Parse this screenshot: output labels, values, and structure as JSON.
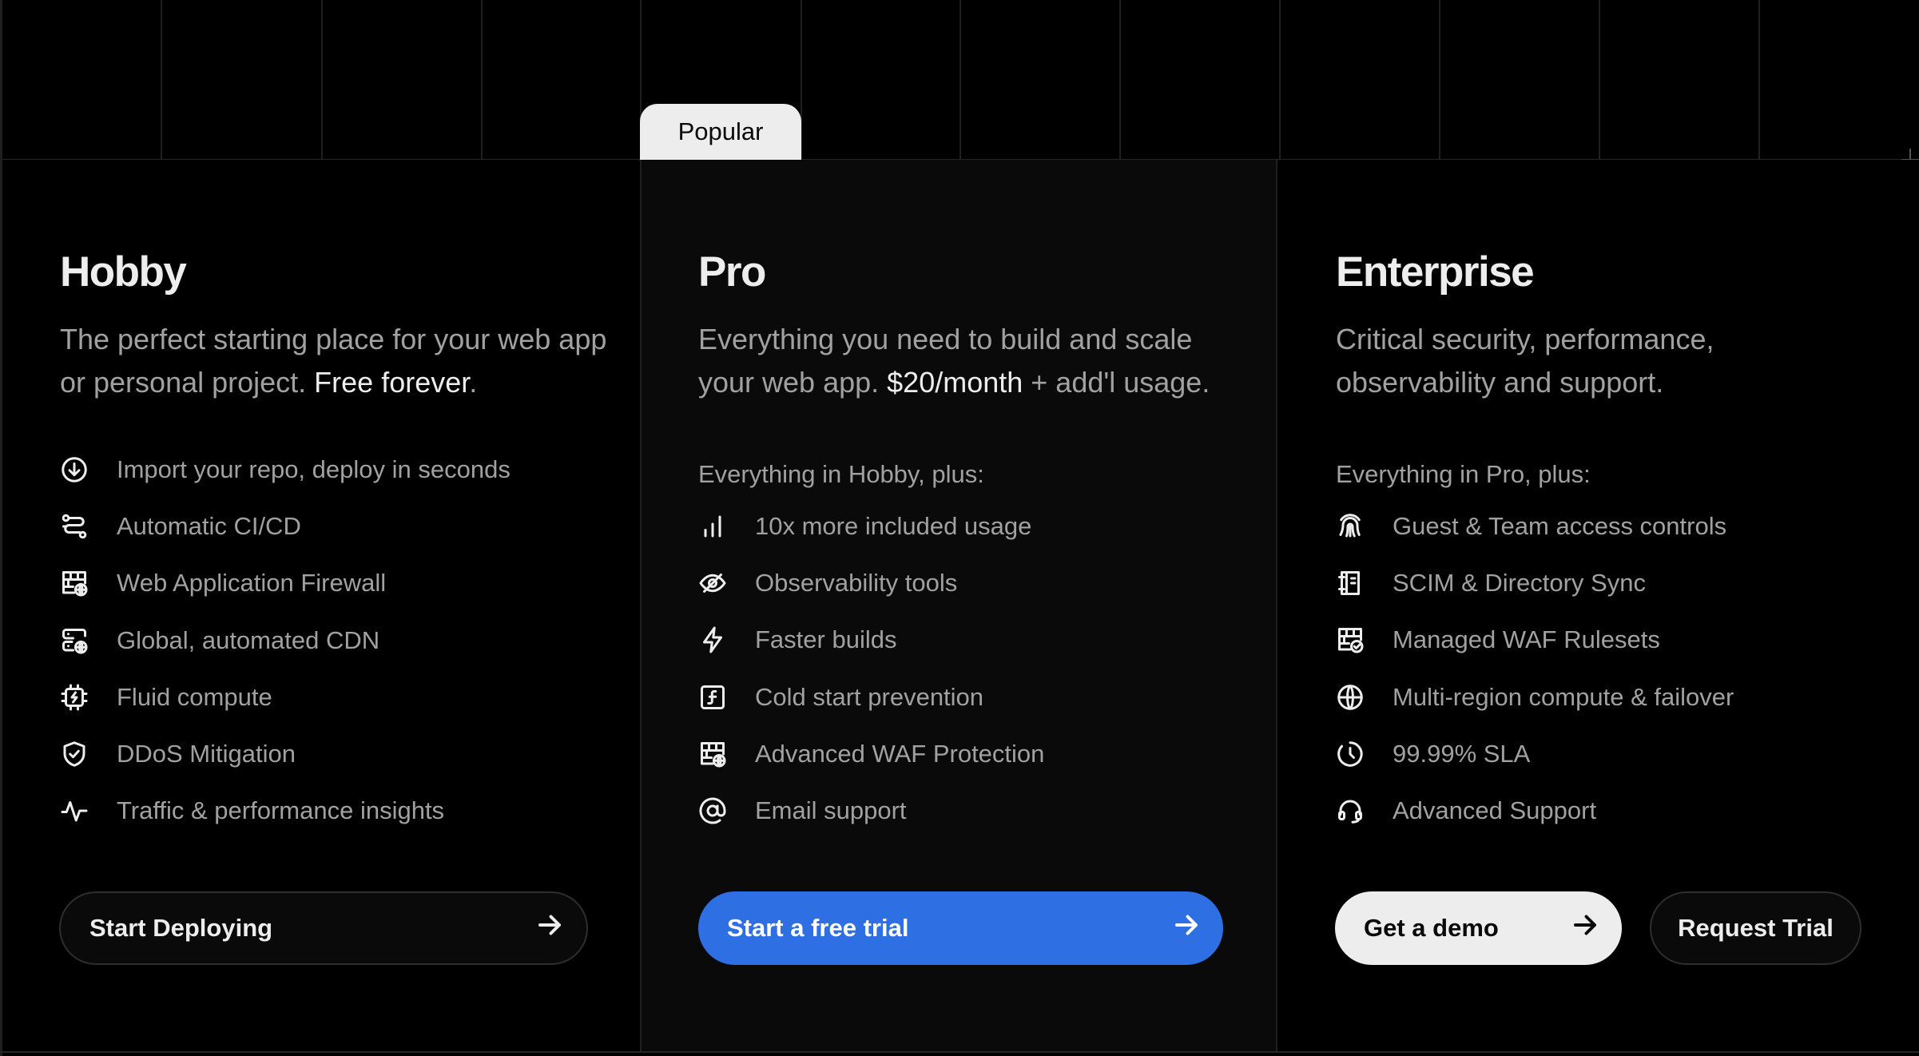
{
  "popular_tab": "Popular",
  "hobby": {
    "title": "Hobby",
    "desc_start": "The perfect starting place for your web app or personal project. ",
    "desc_strong": "Free forever",
    "desc_end": ".",
    "features": [
      {
        "icon": "arrow-circle-down-icon",
        "label": "Import your repo, deploy in seconds"
      },
      {
        "icon": "git-flow-icon",
        "label": "Automatic CI/CD"
      },
      {
        "icon": "firewall-globe-icon",
        "label": "Web Application Firewall"
      },
      {
        "icon": "server-globe-icon",
        "label": "Global, automated CDN"
      },
      {
        "icon": "chip-icon",
        "label": "Fluid compute"
      },
      {
        "icon": "shield-check-icon",
        "label": "DDoS Mitigation"
      },
      {
        "icon": "pulse-icon",
        "label": "Traffic & performance insights"
      }
    ],
    "button": "Start Deploying"
  },
  "pro": {
    "title": "Pro",
    "desc_start": "Everything you need to build and scale your web app. ",
    "desc_strong": "$20/month",
    "desc_end": " + add'l usage.",
    "plus_label": "Everything in Hobby, plus:",
    "features": [
      {
        "icon": "bar-chart-icon",
        "label": "10x more included usage"
      },
      {
        "icon": "eye-icon",
        "label": "Observability tools"
      },
      {
        "icon": "lightning-icon",
        "label": "Faster builds"
      },
      {
        "icon": "function-icon",
        "label": "Cold start prevention"
      },
      {
        "icon": "firewall-globe-icon",
        "label": "Advanced WAF Protection"
      },
      {
        "icon": "at-sign-icon",
        "label": "Email support"
      }
    ],
    "button": "Start a free trial"
  },
  "enterprise": {
    "title": "Enterprise",
    "desc": "Critical security, performance, observability and support.",
    "plus_label": "Everything in Pro, plus:",
    "features": [
      {
        "icon": "fingerprint-icon",
        "label": "Guest & Team access controls"
      },
      {
        "icon": "directory-icon",
        "label": "SCIM & Directory Sync"
      },
      {
        "icon": "firewall-check-icon",
        "label": "Managed WAF Rulesets"
      },
      {
        "icon": "globe-icon",
        "label": "Multi-region compute & failover"
      },
      {
        "icon": "clock-icon",
        "label": "99.99% SLA"
      },
      {
        "icon": "headset-icon",
        "label": "Advanced Support"
      }
    ],
    "demo_button": "Get a demo",
    "trial_button": "Request Trial"
  }
}
